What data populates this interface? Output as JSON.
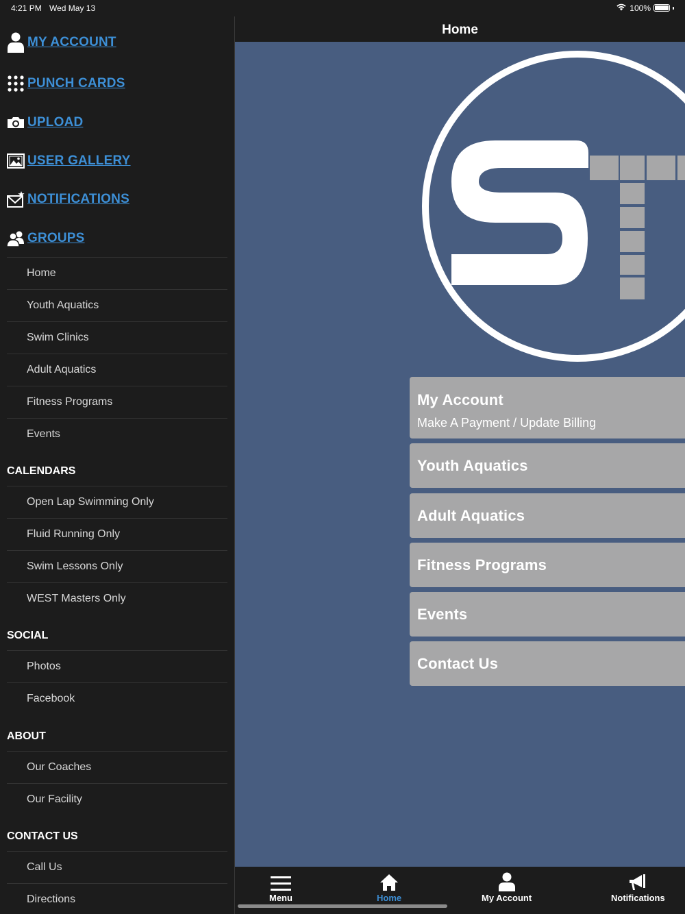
{
  "status_bar": {
    "time": "4:21 PM",
    "date": "Wed May 13",
    "battery": "100%"
  },
  "sidebar": {
    "top_links": [
      {
        "label": "MY ACCOUNT",
        "icon": "user-icon"
      },
      {
        "label": "PUNCH CARDS",
        "icon": "grid-dots-icon"
      },
      {
        "label": "UPLOAD",
        "icon": "camera-icon"
      },
      {
        "label": "USER GALLERY",
        "icon": "image-icon"
      },
      {
        "label": "NOTIFICATIONS",
        "icon": "envelope-star-icon"
      },
      {
        "label": "GROUPS",
        "icon": "group-icon"
      }
    ],
    "groups_items": [
      "Home",
      "Youth Aquatics",
      "Swim Clinics",
      "Adult Aquatics",
      "Fitness Programs",
      "Events"
    ],
    "calendars": {
      "header": "CALENDARS",
      "items": [
        "Open Lap Swimming Only",
        "Fluid Running Only",
        "Swim Lessons Only",
        "WEST Masters Only"
      ]
    },
    "social": {
      "header": "SOCIAL",
      "items": [
        "Photos",
        "Facebook"
      ]
    },
    "about": {
      "header": "ABOUT",
      "items": [
        "Our Coaches",
        "Our Facility"
      ]
    },
    "contact": {
      "header": "CONTACT US",
      "items": [
        "Call Us",
        "Directions"
      ]
    }
  },
  "header": {
    "title": "Home"
  },
  "tiles": [
    {
      "title": "My Account",
      "subtitle": "Make A Payment / Update Billing"
    },
    {
      "title": "Youth Aquatics"
    },
    {
      "title": "Adult Aquatics"
    },
    {
      "title": "Fitness Programs"
    },
    {
      "title": "Events"
    },
    {
      "title": "Contact Us"
    }
  ],
  "tabbar": {
    "tabs": [
      {
        "label": "Menu",
        "icon": "hamburger-icon"
      },
      {
        "label": "Home",
        "icon": "home-icon",
        "active": true
      },
      {
        "label": "My Account",
        "icon": "user-icon"
      },
      {
        "label": "Notifications",
        "icon": "megaphone-icon"
      }
    ]
  },
  "colors": {
    "background": "#1c1c1c",
    "main_bg": "#485d80",
    "link": "#3d8fd6",
    "tile": "#a7a7a8",
    "active_tab": "#3d8fd6"
  }
}
